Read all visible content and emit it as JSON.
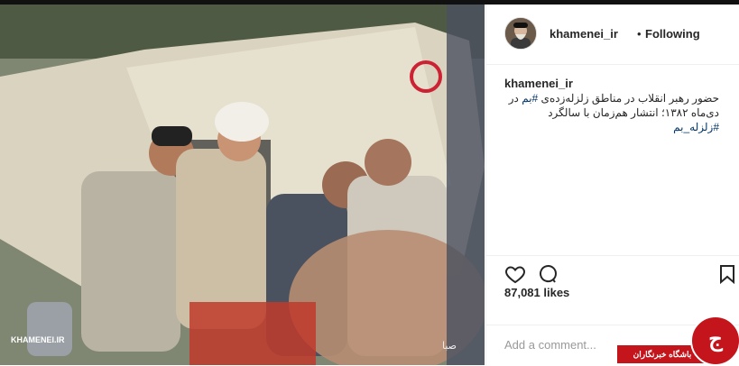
{
  "post": {
    "photo_watermark": "KHAMENEI.IR",
    "photo_signature": "صبا"
  },
  "header": {
    "username": "khamenei_ir",
    "separator": "•",
    "follow_label": "Following"
  },
  "caption": {
    "username": "khamenei_ir",
    "text_line1": "حضور رهبر انقلاب در مناطق زلزله‌زده‌ی ",
    "hashtag1": "#بم",
    "text_line2": " در دی‌ماه ۱۳۸۲؛ انتشار هم‌زمان با سالگرد ",
    "hashtag2": "#زلزله_بم"
  },
  "actions": {
    "like_icon": "heart-icon",
    "comment_icon": "comment-icon",
    "save_icon": "bookmark-icon"
  },
  "likes": "87,081 likes",
  "comment_placeholder": "Add a comment...",
  "watermark": {
    "label": "باشگاه خبرنگاران",
    "logo": "ج"
  },
  "colors": {
    "accent": "#c3151b",
    "hashtag": "#003569",
    "text": "#262626"
  }
}
